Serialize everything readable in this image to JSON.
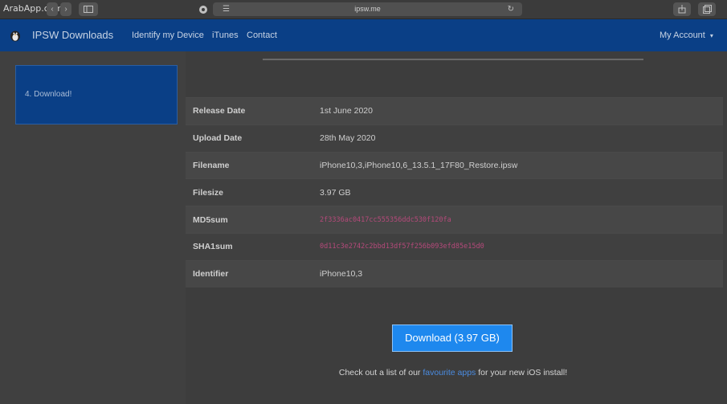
{
  "browser": {
    "watermark": "ArabApp.com",
    "url": "ipsw.me",
    "nav_back": "‹",
    "nav_forward": "›",
    "sidebar_toggle_icon": "sidebar-icon",
    "reload_icon": "reload-icon",
    "share_icon": "share-icon",
    "tabs_icon": "tabs-icon"
  },
  "navbar": {
    "brand": "IPSW Downloads",
    "links": [
      "Identify my Device",
      "iTunes",
      "Contact"
    ],
    "account": "My Account",
    "account_caret": "▾"
  },
  "sidebar": {
    "step_label": "4. Download!"
  },
  "firmware": {
    "rows": [
      {
        "key": "Release Date",
        "value": "1st June 2020"
      },
      {
        "key": "Upload Date",
        "value": "28th May 2020"
      },
      {
        "key": "Filename",
        "value": "iPhone10,3,iPhone10,6_13.5.1_17F80_Restore.ipsw"
      },
      {
        "key": "Filesize",
        "value": "3.97 GB"
      },
      {
        "key": "MD5sum",
        "value": "2f3336ac0417cc555356ddc530f120fa"
      },
      {
        "key": "SHA1sum",
        "value": "0d11c3e2742c2bbd13df57f256b093efd85e15d0"
      },
      {
        "key": "Identifier",
        "value": "iPhone10,3"
      }
    ]
  },
  "download": {
    "button_label": "Download (3.97 GB)"
  },
  "footer": {
    "text_before": "Check out a list of our ",
    "link_text": "favourite apps",
    "text_after": " for your new iOS install!"
  },
  "colors": {
    "navbar": "#0a3f86",
    "download_button": "#1e88ee",
    "hash_text": "#b5497a",
    "link": "#4a8be0"
  }
}
